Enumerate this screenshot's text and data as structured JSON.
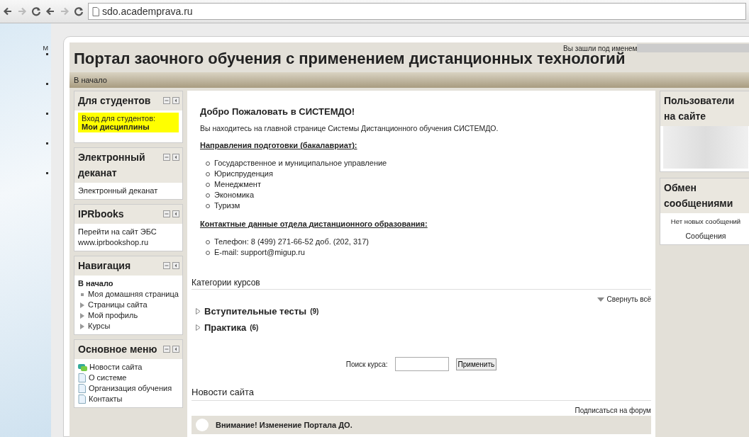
{
  "browser": {
    "address": "sdo.academprava.ru"
  },
  "side_strip": {
    "text": "М"
  },
  "header": {
    "title": "Портал заочного обучения с применением дистанционных технологий",
    "login_text": "Вы зашли под именем"
  },
  "navbar": {
    "home": "В начало"
  },
  "left_blocks": [
    {
      "kind": "highlight",
      "title": "Для студентов",
      "lines": [
        "Вход для студентов:"
      ],
      "link": "Мои дисциплины"
    },
    {
      "kind": "text",
      "title": "Электронный деканат",
      "lines": [
        "Электронный деканат"
      ]
    },
    {
      "kind": "text",
      "title": "IPRbooks",
      "lines": [
        "Перейти на сайт ЭБС",
        "www.iprbookshop.ru"
      ]
    },
    {
      "kind": "navigation",
      "title": "Навигация",
      "home": "В начало",
      "items": [
        {
          "label": "Моя домашняя страница",
          "kind": "leaf"
        },
        {
          "label": "Страницы сайта",
          "kind": "branch"
        },
        {
          "label": "Мой профиль",
          "kind": "branch"
        },
        {
          "label": "Курсы",
          "kind": "branch"
        }
      ]
    },
    {
      "kind": "menu",
      "title": "Основное меню",
      "items": [
        {
          "label": "Новости сайта",
          "kind": "forum"
        },
        {
          "label": "О системе",
          "kind": "page"
        },
        {
          "label": "Организация обучения",
          "kind": "page"
        },
        {
          "label": "Контакты",
          "kind": "page"
        }
      ]
    }
  ],
  "content": {
    "welcome": "Добро Пожаловать в СИСТЕМДО!",
    "intro": "Вы находитесь на главной странице Системы Дистанционного обучения СИСТЕМДО.",
    "directions_heading": "Направления подготовки (бакалавриат):",
    "directions": [
      "Государственное и муниципальное управление",
      "Юриспруденция",
      "Менеджмент",
      "Экономика",
      "Туризм"
    ],
    "contacts_heading": "Контактные данные отдела дистанционного образования:",
    "contacts": [
      "Телефон: 8 (499) 271-66-52 доб. (202, 317)",
      "E-mail: support@migup.ru"
    ],
    "categories_heading": "Категории курсов",
    "collapse_all": "Свернуть всё",
    "categories": [
      {
        "name": "Вступительные тесты",
        "count": "(9)",
        "expanded": false
      },
      {
        "name": "Практика",
        "count": "(6)",
        "expanded": false
      }
    ],
    "search": {
      "label": "Поиск курса:",
      "button": "Применить"
    },
    "news_heading": "Новости сайта",
    "subscribe": "Подписаться на форум",
    "news": [
      {
        "title": "Внимание! Изменение Портала ДО."
      }
    ]
  },
  "right_blocks": [
    {
      "kind": "users",
      "title": "Пользователи на сайте"
    },
    {
      "kind": "messages",
      "title": "Обмен сообщениями",
      "lines": [
        "Нет новых сообщений"
      ],
      "link": "Сообщения"
    }
  ]
}
